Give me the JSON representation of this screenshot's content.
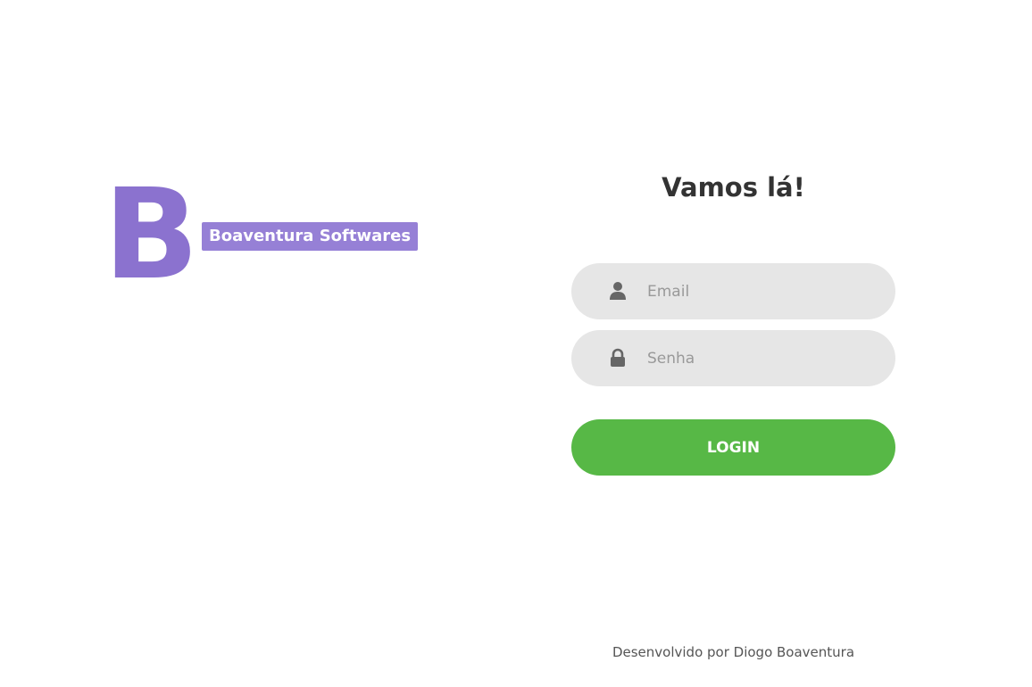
{
  "brand": {
    "letter": "B",
    "name": "Boaventura Softwares",
    "accent_color": "#8b72cf"
  },
  "login": {
    "title": "Vamos lá!",
    "email_placeholder": "Email",
    "email_value": "",
    "email_icon": "user-icon",
    "password_placeholder": "Senha",
    "password_value": "",
    "password_icon": "lock-icon",
    "submit_label": "LOGIN",
    "submit_color": "#57b846"
  },
  "footer": {
    "credit": "Desenvolvido por Diogo Boaventura"
  }
}
